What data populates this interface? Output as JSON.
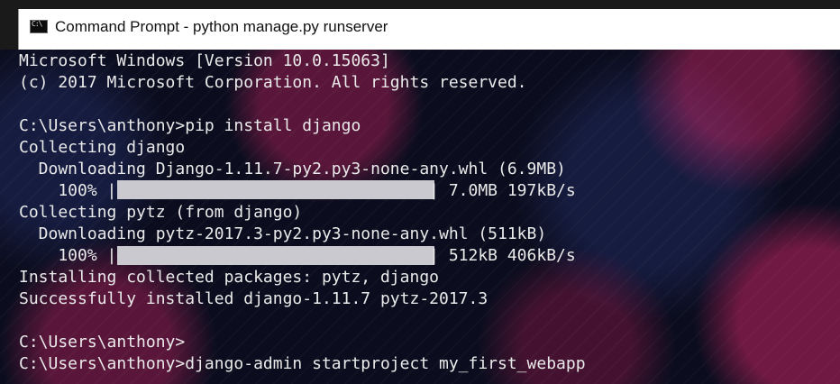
{
  "window": {
    "title": "Command Prompt - python  manage.py runserver",
    "icon": "cmd-icon"
  },
  "console": {
    "lines": [
      "Microsoft Windows [Version 10.0.15063]",
      "(c) 2017 Microsoft Corporation. All rights reserved.",
      "",
      "C:\\Users\\anthony>pip install django",
      "Collecting django",
      "  Downloading Django-1.11.7-py2.py3-none-any.whl (6.9MB)",
      "    100% |                                | 7.0MB 197kB/s",
      "Collecting pytz (from django)",
      "  Downloading pytz-2017.3-py2.py3-none-any.whl (511kB)",
      "    100% |                                | 512kB 406kB/s",
      "Installing collected packages: pytz, django",
      "Successfully installed django-1.11.7 pytz-2017.3",
      "",
      "C:\\Users\\anthony>",
      "C:\\Users\\anthony>django-admin startproject my_first_webapp"
    ],
    "progress": {
      "django_download": 1.0,
      "pytz_download": 1.0
    }
  }
}
